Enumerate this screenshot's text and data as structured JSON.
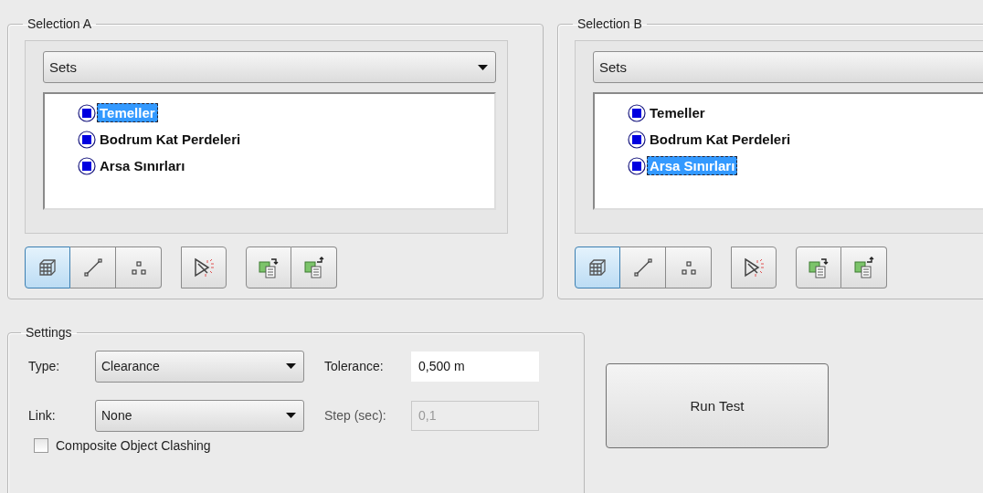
{
  "selections": [
    {
      "title": "Selection A",
      "dropdown": "Sets",
      "items": [
        {
          "label": "Temeller",
          "selected": true
        },
        {
          "label": "Bodrum Kat Perdeleri",
          "selected": false
        },
        {
          "label": "Arsa Sınırları",
          "selected": false
        }
      ],
      "modes": [
        {
          "kind": "surface",
          "selected": true
        },
        {
          "kind": "line",
          "selected": false
        },
        {
          "kind": "point",
          "selected": false
        }
      ]
    },
    {
      "title": "Selection B",
      "dropdown": "Sets",
      "cut_off": true,
      "items": [
        {
          "label": "Temeller",
          "selected": false
        },
        {
          "label": "Bodrum Kat Perdeleri",
          "selected": false
        },
        {
          "label": "Arsa Sınırları",
          "selected": true
        }
      ],
      "modes": [
        {
          "kind": "surface",
          "selected": true
        },
        {
          "kind": "line",
          "selected": false
        },
        {
          "kind": "point",
          "selected": false
        }
      ]
    }
  ],
  "settings": {
    "title": "Settings",
    "type": {
      "label": "Type:",
      "value": "Clearance"
    },
    "tolerance": {
      "label": "Tolerance:",
      "value": "0,500 m"
    },
    "link": {
      "label": "Link:",
      "value": "None"
    },
    "step": {
      "label": "Step (sec):",
      "value": "0,1",
      "disabled": true
    },
    "composite": {
      "label": "Composite Object Clashing",
      "checked": false
    }
  },
  "run_button": "Run Test"
}
